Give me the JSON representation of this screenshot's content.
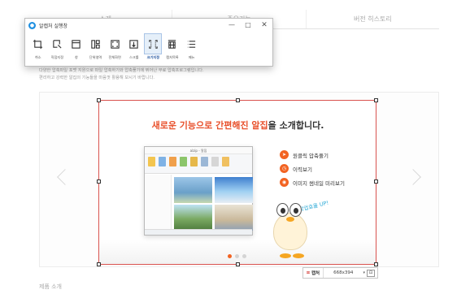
{
  "page": {
    "tabs": [
      {
        "label": "소개"
      },
      {
        "label": "주요기능"
      },
      {
        "label": "버전 히스토리"
      }
    ],
    "description_lines": [
      "다양한 압축파일 포맷 지원으로 파일 압축하기와 압축풀기에 뛰어난 무료 압축프로그램입니다.",
      "편리하고 강력한 알집의 기능들을 마음껏 활용해 보시기 바랍니다."
    ],
    "bottom_text": "제품 소개"
  },
  "banner": {
    "title_highlight": "새로운 기능으로 간편해진 알집",
    "title_rest": "을 소개합니다.",
    "features": [
      {
        "label": "원클릭 압축풀기"
      },
      {
        "label": "이력보기"
      },
      {
        "label": "이미지 썸네일 미리보기"
      }
    ],
    "handwriting": "작업효율 UP!",
    "mini_window_title": "alzip - 알집",
    "active_slide": 0,
    "slide_count": 3
  },
  "capture_window": {
    "title": "알캡처 실행창",
    "minimize": "—",
    "maximize": "□",
    "close": "✕",
    "tools": [
      {
        "label": "취소",
        "icon": "cancel-crop-icon"
      },
      {
        "label": "직접지정",
        "icon": "direct-select-icon"
      },
      {
        "label": "창",
        "icon": "window-icon"
      },
      {
        "label": "단위영역",
        "icon": "unit-area-icon"
      },
      {
        "label": "전체화면",
        "icon": "fullscreen-icon"
      },
      {
        "label": "스크롤",
        "icon": "scroll-icon"
      },
      {
        "label": "크기지정",
        "icon": "size-select-icon",
        "selected": true
      },
      {
        "label": "캡처목록",
        "icon": "capture-list-icon"
      },
      {
        "label": "메뉴",
        "icon": "menu-icon"
      }
    ]
  },
  "selection": {
    "crop_label": "캡처",
    "size": "668x394",
    "dropdown": "▾",
    "pin": "⊡"
  },
  "colors": {
    "accent_orange": "#f26322",
    "selection_red": "#d9534f",
    "selected_tool_bg": "#e5eff9",
    "handwriting_blue": "#2aa9d6"
  }
}
